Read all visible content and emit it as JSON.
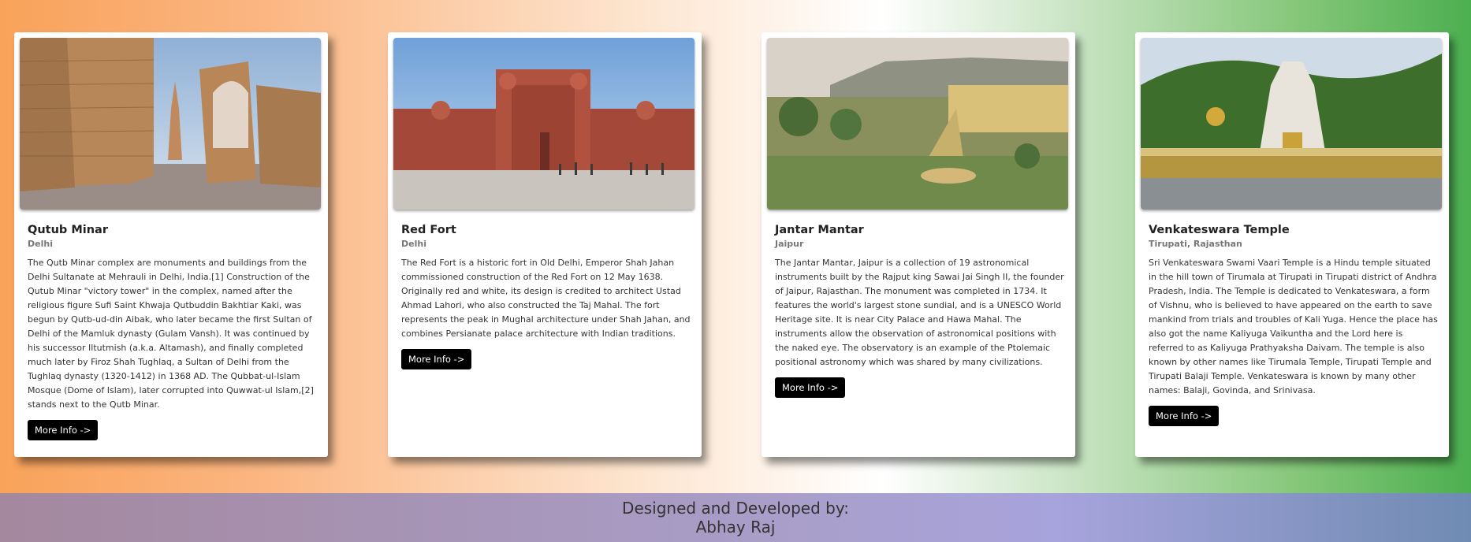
{
  "cards": [
    {
      "title": "Qutub Minar",
      "subtitle": "Delhi",
      "text": "The Qutb Minar complex are monuments and buildings from the Delhi Sultanate at Mehrauli in Delhi, India.[1] Construction of the Qutub Minar \"victory tower\" in the complex, named after the religious figure Sufi Saint Khwaja Qutbuddin Bakhtiar Kaki, was begun by Qutb-ud-din Aibak, who later became the first Sultan of Delhi of the Mamluk dynasty (Gulam Vansh). It was continued by his successor Iltutmish (a.k.a. Altamash), and finally completed much later by Firoz Shah Tughlaq, a Sultan of Delhi from the Tughlaq dynasty (1320-1412) in 1368 AD. The Qubbat-ul-Islam Mosque (Dome of Islam), later corrupted into Quwwat-ul Islam,[2] stands next to the Qutb Minar.",
      "button": "More Info ->"
    },
    {
      "title": "Red Fort",
      "subtitle": "Delhi",
      "text": "The Red Fort is a historic fort in Old Delhi, Emperor Shah Jahan commissioned construction of the Red Fort on 12 May 1638. Originally red and white, its design is credited to architect Ustad Ahmad Lahori, who also constructed the Taj Mahal. The fort represents the peak in Mughal architecture under Shah Jahan, and combines Persianate palace architecture with Indian traditions.",
      "button": "More Info ->"
    },
    {
      "title": "Jantar Mantar",
      "subtitle": "Jaipur",
      "text": "The Jantar Mantar, Jaipur is a collection of 19 astronomical instruments built by the Rajput king Sawai Jai Singh II, the founder of Jaipur, Rajasthan. The monument was completed in 1734. It features the world's largest stone sundial, and is a UNESCO World Heritage site. It is near City Palace and Hawa Mahal. The instruments allow the observation of astronomical positions with the naked eye. The observatory is an example of the Ptolemaic positional astronomy which was shared by many civilizations.",
      "button": "More Info ->"
    },
    {
      "title": "Venkateswara Temple",
      "subtitle": "Tirupati, Rajasthan",
      "text": "Sri Venkateswara Swami Vaari Temple is a Hindu temple situated in the hill town of Tirumala at Tirupati in Tirupati district of Andhra Pradesh, India. The Temple is dedicated to Venkateswara, a form of Vishnu, who is believed to have appeared on the earth to save mankind from trials and troubles of Kali Yuga. Hence the place has also got the name Kaliyuga Vaikuntha and the Lord here is referred to as Kaliyuga Prathyaksha Daivam. The temple is also known by other names like Tirumala Temple, Tirupati Temple and Tirupati Balaji Temple. Venkateswara is known by many other names: Balaji, Govinda, and Srinivasa.",
      "button": "More Info ->"
    }
  ],
  "footer": {
    "line1": "Designed and Developed by:",
    "line2": "Abhay Raj"
  },
  "colors": {
    "saffron": "#f9a25a",
    "green": "#4caf50",
    "button_bg": "#000000",
    "footer_left": "#a4889e",
    "footer_right": "#6f8bb3"
  }
}
